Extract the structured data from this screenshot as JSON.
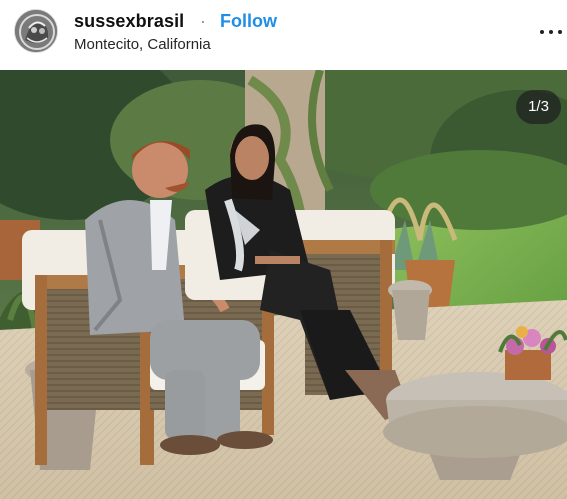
{
  "post": {
    "username": "sussexbrasil",
    "separator": "·",
    "follow_label": "Follow",
    "location": "Montecito, California",
    "more_icon": "more-horizontal-icon",
    "carousel": {
      "current": 1,
      "total": 3,
      "counter_label": "1/3"
    }
  },
  "colors": {
    "follow": "#1e8ee6",
    "username": "#111111",
    "location": "#262626"
  }
}
